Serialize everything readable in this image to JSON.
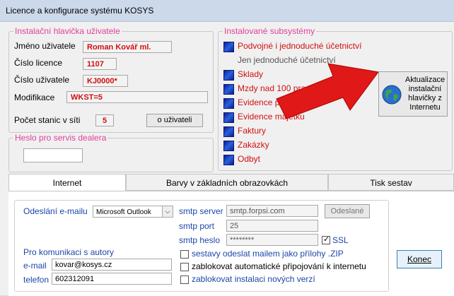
{
  "window": {
    "title": "Licence a konfigurace systému KOSYS"
  },
  "user_header": {
    "legend": "Instalační hlavička uživatele",
    "name_label": "Jméno uživatele",
    "name_value": "Roman Kovář ml.",
    "licence_label": "Číslo licence",
    "licence_value": "1107",
    "user_no_label": "Číslo uživatele",
    "user_no_value": "KJ0000*",
    "modification_label": "Modifikace",
    "modification_value": "WKST=5",
    "stations_label": "Počet stanic v síti",
    "stations_value": "5",
    "about_user_button": "o uživateli"
  },
  "dealer": {
    "legend": "Heslo pro servis dealera",
    "password_value": ""
  },
  "subsystems": {
    "legend": "Instalované subsystémy",
    "items": [
      {
        "label": "Podvojné i jednoduché účetnictví",
        "active": true
      },
      {
        "label": "Jen jednoduché účetnictví",
        "active": false
      },
      {
        "label": "Sklady",
        "active": true
      },
      {
        "label": "Mzdy nad 100 pracovníků",
        "active": true
      },
      {
        "label": "Evidence pracovníků",
        "active": true
      },
      {
        "label": "Evidence majetku",
        "active": true
      },
      {
        "label": "Faktury",
        "active": true
      },
      {
        "label": "Zakázky",
        "active": true
      },
      {
        "label": "Odbyt",
        "active": true
      }
    ],
    "update_button": [
      "Aktualizace",
      "instalační",
      "hlavičky z",
      "Internetu"
    ]
  },
  "tabs": [
    {
      "label": "Internet",
      "active": true
    },
    {
      "label": "Barvy v základních obrazovkách",
      "active": false
    },
    {
      "label": "Tisk sestav",
      "active": false
    }
  ],
  "internet": {
    "send_label": "Odeslání e-mailu",
    "send_value": "Microsoft Outlook",
    "smtp_server_label": "smtp server",
    "smtp_server_value": "smtp.forpsi.com",
    "smtp_port_label": "smtp port",
    "smtp_port_value": "25",
    "smtp_password_label": "smtp heslo",
    "smtp_password_value": "********",
    "ssl_label": "SSL",
    "ssl_checked": true,
    "sent_button": "Odeslané",
    "contact_heading": "Pro komunikaci s autory",
    "email_label": "e-mail",
    "email_value": "kovar@kosys.cz",
    "phone_label": "telefon",
    "phone_value": "602312091",
    "options": [
      {
        "label": "sestavy odeslat mailem jako přílohy .ZIP",
        "checked": false
      },
      {
        "label": "zablokovat automatické připojování k internetu",
        "checked": false
      },
      {
        "label": "zablokovat instalaci nových verzí",
        "checked": false
      }
    ],
    "close_button": "Konec"
  },
  "colors": {
    "accent_red": "#d01010",
    "legend_pink": "#e0409a",
    "label_blue": "#1c47a8"
  }
}
